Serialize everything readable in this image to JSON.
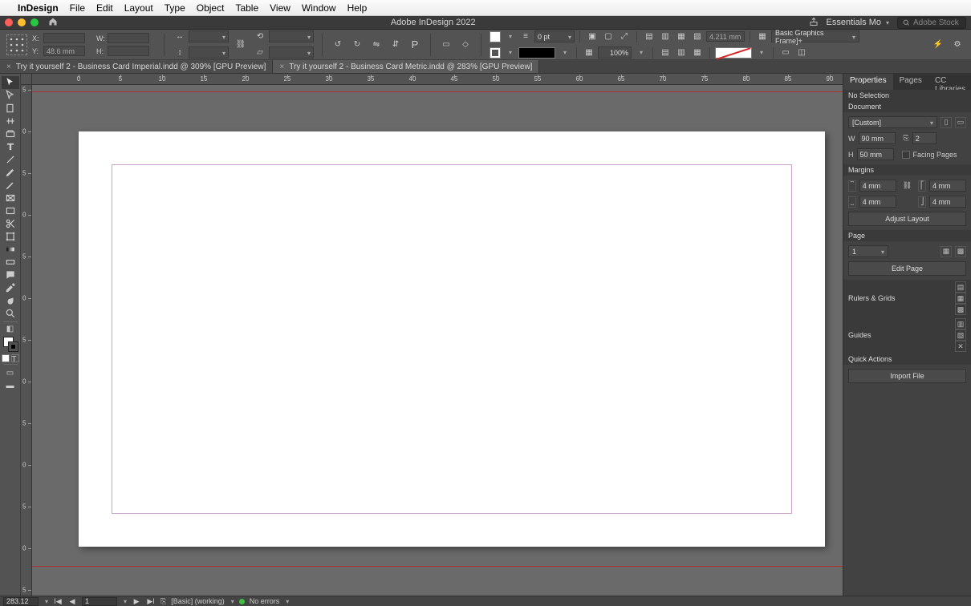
{
  "menubar": {
    "app": "InDesign",
    "items": [
      "File",
      "Edit",
      "Layout",
      "Type",
      "Object",
      "Table",
      "View",
      "Window",
      "Help"
    ]
  },
  "titlebar": {
    "title": "Adobe InDesign 2022",
    "workspace": "Essentials Mo",
    "stock_placeholder": "Adobe Stock"
  },
  "control": {
    "x": "",
    "y": "48.6 mm",
    "w": "",
    "h": "",
    "stroke_pt": "0 pt",
    "opacity": "100%",
    "gap_val": "4.211 mm",
    "style": "Basic Graphics Frame]+"
  },
  "doc_tabs": [
    "Try it yourself 2 - Business Card Imperial.indd @ 309% [GPU Preview]",
    "Try it yourself 2 - Business Card Metric.indd @ 283% [GPU Preview]"
  ],
  "ruler_h": [
    "0",
    "5",
    "10",
    "15",
    "20",
    "25",
    "30",
    "35",
    "40",
    "45",
    "50",
    "55",
    "60",
    "65",
    "70",
    "75",
    "80",
    "85",
    "90"
  ],
  "ruler_v": [
    "5",
    "0",
    "5",
    "0",
    "5",
    "0",
    "5",
    "0",
    "5",
    "0",
    "5",
    "0",
    "5"
  ],
  "panel": {
    "tabs": [
      "Properties",
      "Pages",
      "CC Libraries"
    ],
    "no_selection": "No Selection",
    "document": {
      "title": "Document",
      "preset": "[Custom]",
      "w": "90 mm",
      "h": "50 mm",
      "pages": "2",
      "facing": "Facing Pages"
    },
    "margins": {
      "title": "Margins",
      "t": "4 mm",
      "b": "4 mm",
      "l": "4 mm",
      "r": "4 mm",
      "adjust": "Adjust Layout"
    },
    "page": {
      "title": "Page",
      "num": "1",
      "edit": "Edit Page"
    },
    "rulers": "Rulers & Grids",
    "guides": "Guides",
    "quick": {
      "title": "Quick Actions",
      "import": "Import File"
    }
  },
  "status": {
    "zoom": "283.12",
    "page": "1",
    "profile": "[Basic] (working)",
    "errors": "No errors"
  }
}
